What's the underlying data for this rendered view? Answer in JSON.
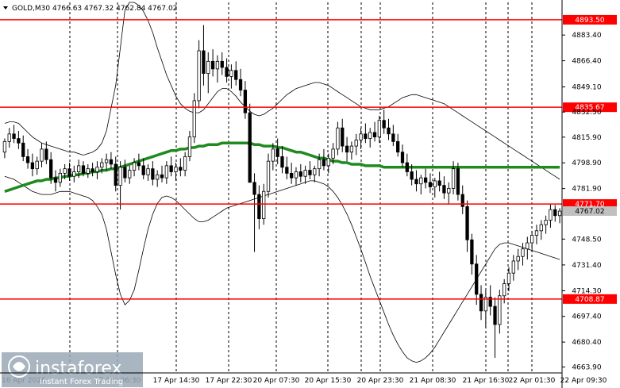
{
  "chart_data": {
    "type": "candlestick",
    "title": "GOLD,M30  4766.63 4767.32 4762.84 4767.02",
    "symbol": "GOLD,M30",
    "ohlc_header": "4766.63 4767.32 4762.84 4767.02",
    "ylim": [
      4660.0,
      4905.0
    ],
    "y_ticks": [
      4883.4,
      4866.4,
      4849.1,
      4832.5,
      4815.9,
      4798.9,
      4781.9,
      4748.5,
      4731.4,
      4714.3,
      4697.4,
      4680.4,
      4663.9
    ],
    "x_ticks": [
      "16 Apr 2026",
      "17 Apr 06:30",
      "17 Apr 14:30",
      "17 Apr 22:30",
      "20 Apr 07:30",
      "20 Apr 15:30",
      "20 Apr 23:30",
      "21 Apr 08:30",
      "21 Apr 16:30",
      "22 Apr 01:30",
      "22 Apr 09:30"
    ],
    "x_ticks_visible": [
      "16 Apr 2026",
      "17 Apr 06:30",
      "17 Apr 14:30",
      "17 Apr 22:30",
      "20 Apr 07:30",
      "20 Apr 15:30",
      "20 Apr 23:30",
      "21 Apr 08:30",
      "21 Apr 16:30",
      "22 Apr 01:30",
      "22 Apr 09:30"
    ],
    "levels": [
      {
        "label": "4893.50",
        "value": 4893.5
      },
      {
        "label": "4835.67",
        "value": 4835.67
      },
      {
        "label": "4771.70",
        "value": 4771.7
      },
      {
        "label": "4708.87",
        "value": 4708.87
      }
    ],
    "current_price": {
      "label": "4767.02",
      "value": 4767.02
    },
    "candles": [
      [
        4806,
        4815,
        4802,
        4813
      ],
      [
        4813,
        4822,
        4809,
        4818
      ],
      [
        4818,
        4824,
        4812,
        4815
      ],
      [
        4815,
        4820,
        4808,
        4812
      ],
      [
        4812,
        4817,
        4800,
        4803
      ],
      [
        4803,
        4808,
        4795,
        4799
      ],
      [
        4799,
        4805,
        4790,
        4795
      ],
      [
        4795,
        4803,
        4791,
        4800
      ],
      [
        4800,
        4812,
        4796,
        4808
      ],
      [
        4808,
        4813,
        4798,
        4801
      ],
      [
        4801,
        4806,
        4785,
        4789
      ],
      [
        4789,
        4794,
        4780,
        4786
      ],
      [
        4786,
        4795,
        4783,
        4792
      ],
      [
        4792,
        4798,
        4788,
        4795
      ],
      [
        4795,
        4799,
        4787,
        4790
      ],
      [
        4790,
        4797,
        4786,
        4793
      ],
      [
        4793,
        4801,
        4789,
        4797
      ],
      [
        4797,
        4800,
        4790,
        4792
      ],
      [
        4792,
        4798,
        4789,
        4795
      ],
      [
        4795,
        4799,
        4790,
        4793
      ],
      [
        4793,
        4800,
        4788,
        4796
      ],
      [
        4796,
        4802,
        4792,
        4799
      ],
      [
        4799,
        4805,
        4794,
        4801
      ],
      [
        4801,
        4806,
        4795,
        4798
      ],
      [
        4798,
        4803,
        4780,
        4784
      ],
      [
        4784,
        4800,
        4768,
        4796
      ],
      [
        4796,
        4801,
        4786,
        4789
      ],
      [
        4789,
        4797,
        4785,
        4794
      ],
      [
        4794,
        4802,
        4790,
        4799
      ],
      [
        4799,
        4805,
        4794,
        4797
      ],
      [
        4797,
        4802,
        4788,
        4791
      ],
      [
        4791,
        4798,
        4787,
        4795
      ],
      [
        4795,
        4800,
        4784,
        4788
      ],
      [
        4788,
        4794,
        4783,
        4791
      ],
      [
        4791,
        4797,
        4786,
        4789
      ],
      [
        4789,
        4800,
        4785,
        4797
      ],
      [
        4797,
        4803,
        4790,
        4793
      ],
      [
        4793,
        4799,
        4787,
        4796
      ],
      [
        4796,
        4802,
        4790,
        4794
      ],
      [
        4794,
        4806,
        4790,
        4803
      ],
      [
        4803,
        4820,
        4800,
        4816
      ],
      [
        4816,
        4845,
        4812,
        4840
      ],
      [
        4840,
        4880,
        4835,
        4873
      ],
      [
        4873,
        4890,
        4850,
        4858
      ],
      [
        4858,
        4872,
        4845,
        4866
      ],
      [
        4866,
        4874,
        4856,
        4861
      ],
      [
        4861,
        4870,
        4852,
        4866
      ],
      [
        4866,
        4872,
        4857,
        4862
      ],
      [
        4862,
        4868,
        4852,
        4856
      ],
      [
        4856,
        4864,
        4848,
        4860
      ],
      [
        4860,
        4866,
        4850,
        4854
      ],
      [
        4854,
        4861,
        4843,
        4847
      ],
      [
        4847,
        4853,
        4828,
        4832
      ],
      [
        4832,
        4838,
        4800,
        4786
      ],
      [
        4786,
        4792,
        4740,
        4778
      ],
      [
        4778,
        4784,
        4755,
        4762
      ],
      [
        4762,
        4785,
        4758,
        4780
      ],
      [
        4780,
        4805,
        4776,
        4800
      ],
      [
        4800,
        4812,
        4794,
        4808
      ],
      [
        4808,
        4815,
        4798,
        4803
      ],
      [
        4803,
        4810,
        4792,
        4796
      ],
      [
        4796,
        4803,
        4788,
        4792
      ],
      [
        4792,
        4799,
        4785,
        4789
      ],
      [
        4789,
        4796,
        4784,
        4793
      ],
      [
        4793,
        4798,
        4786,
        4790
      ],
      [
        4790,
        4797,
        4785,
        4794
      ],
      [
        4794,
        4800,
        4788,
        4791
      ],
      [
        4791,
        4797,
        4786,
        4795
      ],
      [
        4795,
        4805,
        4790,
        4801
      ],
      [
        4801,
        4808,
        4794,
        4797
      ],
      [
        4797,
        4805,
        4792,
        4802
      ],
      [
        4802,
        4812,
        4798,
        4808
      ],
      [
        4808,
        4826,
        4804,
        4822
      ],
      [
        4822,
        4828,
        4806,
        4810
      ],
      [
        4810,
        4816,
        4800,
        4806
      ],
      [
        4806,
        4813,
        4801,
        4810
      ],
      [
        4810,
        4818,
        4804,
        4814
      ],
      [
        4814,
        4822,
        4808,
        4818
      ],
      [
        4818,
        4825,
        4812,
        4815
      ],
      [
        4815,
        4822,
        4809,
        4819
      ],
      [
        4819,
        4826,
        4813,
        4816
      ],
      [
        4816,
        4830,
        4812,
        4827
      ],
      [
        4827,
        4834,
        4818,
        4822
      ],
      [
        4822,
        4828,
        4814,
        4818
      ],
      [
        4818,
        4824,
        4810,
        4813
      ],
      [
        4813,
        4818,
        4803,
        4806
      ],
      [
        4806,
        4811,
        4796,
        4799
      ],
      [
        4799,
        4805,
        4790,
        4793
      ],
      [
        4793,
        4798,
        4784,
        4788
      ],
      [
        4788,
        4794,
        4780,
        4785
      ],
      [
        4785,
        4791,
        4778,
        4789
      ],
      [
        4789,
        4795,
        4782,
        4786
      ],
      [
        4786,
        4792,
        4779,
        4783
      ],
      [
        4783,
        4789,
        4776,
        4787
      ],
      [
        4787,
        4793,
        4780,
        4784
      ],
      [
        4784,
        4790,
        4775,
        4779
      ],
      [
        4779,
        4786,
        4772,
        4782
      ],
      [
        4782,
        4800,
        4778,
        4795
      ],
      [
        4795,
        4799,
        4774,
        4778
      ],
      [
        4778,
        4784,
        4765,
        4770
      ],
      [
        4770,
        4774,
        4740,
        4748
      ],
      [
        4748,
        4752,
        4725,
        4732
      ],
      [
        4732,
        4738,
        4705,
        4712
      ],
      [
        4712,
        4718,
        4695,
        4701
      ],
      [
        4701,
        4715,
        4690,
        4710
      ],
      [
        4710,
        4718,
        4698,
        4704
      ],
      [
        4704,
        4710,
        4670,
        4692
      ],
      [
        4692,
        4715,
        4686,
        4711
      ],
      [
        4711,
        4722,
        4706,
        4719
      ],
      [
        4719,
        4730,
        4714,
        4726
      ],
      [
        4726,
        4738,
        4721,
        4734
      ],
      [
        4734,
        4742,
        4728,
        4737
      ],
      [
        4737,
        4746,
        4731,
        4742
      ],
      [
        4742,
        4750,
        4735,
        4746
      ],
      [
        4746,
        4754,
        4740,
        4751
      ],
      [
        4751,
        4758,
        4745,
        4754
      ],
      [
        4754,
        4761,
        4748,
        4758
      ],
      [
        4758,
        4764,
        4752,
        4761
      ],
      [
        4761,
        4772,
        4756,
        4768
      ],
      [
        4768,
        4771,
        4760,
        4764
      ],
      [
        4764,
        4769,
        4759,
        4767
      ]
    ],
    "series": [
      {
        "values": [
          4780,
          4781,
          4782,
          4783,
          4784,
          4785,
          4786,
          4787,
          4787,
          4788,
          4788,
          4789,
          4789,
          4790,
          4790,
          4791,
          4791,
          4792,
          4792,
          4793,
          4793,
          4794,
          4794,
          4795,
          4795,
          4796,
          4797,
          4798,
          4799,
          4800,
          4801,
          4802,
          4803,
          4804,
          4805,
          4806,
          4807,
          4807,
          4808,
          4808,
          4809,
          4809,
          4810,
          4810,
          4811,
          4811,
          4811,
          4812,
          4812,
          4812,
          4812,
          4812,
          4812,
          4812,
          4811,
          4811,
          4810,
          4810,
          4810,
          4809,
          4809,
          4808,
          4807,
          4806,
          4806,
          4805,
          4804,
          4803,
          4802,
          4802,
          4801,
          4800,
          4800,
          4799,
          4799,
          4798,
          4798,
          4798,
          4797,
          4797,
          4797,
          4797,
          4796,
          4796,
          4796,
          4796,
          4796,
          4796,
          4796,
          4796,
          4796,
          4796,
          4796,
          4796,
          4796,
          4796,
          4796,
          4796,
          4796,
          4796,
          4796,
          4796,
          4796,
          4796,
          4796,
          4796,
          4796,
          4796,
          4796,
          4796,
          4796,
          4796,
          4796,
          4796,
          4796,
          4796,
          4796,
          4796,
          4796,
          4796,
          4796,
          4796
        ]
      },
      {
        "values": [
          4825,
          4826,
          4826,
          4825,
          4822,
          4819,
          4816,
          4814,
          4812,
          4811,
          4810,
          4809,
          4808,
          4807,
          4806,
          4806,
          4805,
          4804,
          4805,
          4806,
          4808,
          4812,
          4820,
          4835,
          4850,
          4875,
          4900,
          4905,
          4905,
          4903,
          4899,
          4893,
          4885,
          4875,
          4866,
          4857,
          4850,
          4843,
          4838,
          4835,
          4833,
          4832,
          4832,
          4834,
          4838,
          4842,
          4846,
          4848,
          4848,
          4846,
          4843,
          4839,
          4836,
          4833,
          4831,
          4830,
          4831,
          4833,
          4835,
          4838,
          4841,
          4844,
          4846,
          4848,
          4849,
          4850,
          4851,
          4852,
          4852,
          4851,
          4850,
          4848,
          4846,
          4844,
          4842,
          4840,
          4838,
          4836,
          4835,
          4834,
          4834,
          4834,
          4835,
          4836,
          4838,
          4840,
          4842,
          4843,
          4844,
          4844,
          4843,
          4842,
          4841,
          4840,
          4839,
          4838,
          4836,
          4834,
          4832,
          4830,
          4828,
          4826,
          4824,
          4822,
          4820,
          4818,
          4816,
          4814,
          4812,
          4810,
          4808,
          4806,
          4804,
          4802,
          4800,
          4798,
          4796,
          4794,
          4792,
          4790,
          4788,
          4786
        ]
      },
      {
        "values": [
          4790,
          4789,
          4788,
          4786,
          4784,
          4782,
          4780,
          4779,
          4778,
          4778,
          4778,
          4779,
          4780,
          4780,
          4780,
          4779,
          4778,
          4777,
          4776,
          4774,
          4770,
          4765,
          4755,
          4740,
          4725,
          4712,
          4705,
          4708,
          4715,
          4728,
          4742,
          4755,
          4765,
          4772,
          4776,
          4777,
          4776,
          4774,
          4771,
          4768,
          4765,
          4762,
          4760,
          4760,
          4761,
          4763,
          4765,
          4767,
          4769,
          4770,
          4771,
          4772,
          4773,
          4774,
          4775,
          4776,
          4777,
          4778,
          4779,
          4780,
          4781,
          4782,
          4783,
          4784,
          4785,
          4786,
          4787,
          4787,
          4786,
          4785,
          4783,
          4780,
          4776,
          4771,
          4765,
          4758,
          4750,
          4742,
          4733,
          4724,
          4716,
          4708,
          4700,
          4692,
          4685,
          4679,
          4674,
          4670,
          4668,
          4667,
          4668,
          4670,
          4673,
          4677,
          4682,
          4687,
          4692,
          4697,
          4702,
          4707,
          4712,
          4717,
          4722,
          4727,
          4732,
          4737,
          4742,
          4745,
          4746,
          4746,
          4745,
          4744,
          4743,
          4742,
          4741,
          4740,
          4739,
          4738,
          4737,
          4736,
          4735,
          4734
        ]
      }
    ]
  },
  "watermark": {
    "brand": "instaforex",
    "tagline": "Instant Forex Trading"
  },
  "colors": {
    "level_line": "#ff0000",
    "level_tag_bg": "#ff0000",
    "ma_line": "#1f8a1f",
    "band_line": "#000000",
    "candle": "#000000",
    "current_tag_bg": "#c0c0c0",
    "watermark_bg": "#9aa8b5"
  }
}
